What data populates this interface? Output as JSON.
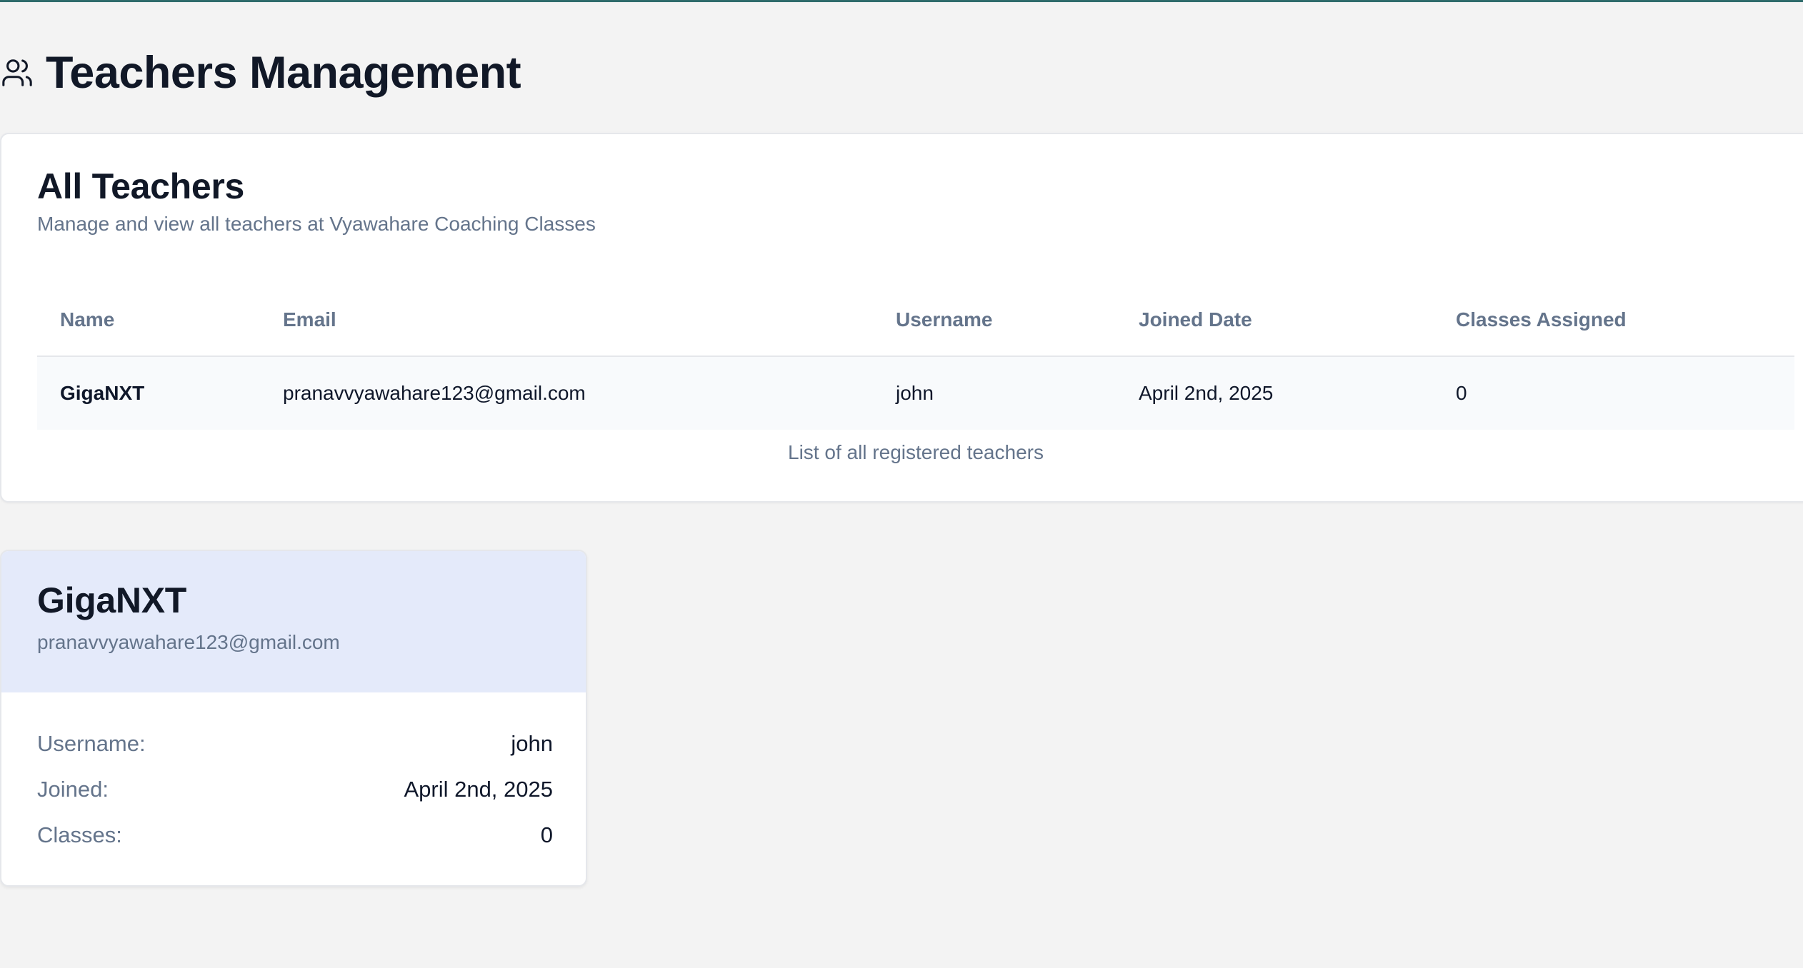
{
  "page": {
    "title": "Teachers Management",
    "icon": "users-icon"
  },
  "all_teachers": {
    "title": "All Teachers",
    "description": "Manage and view all teachers at Vyawahare Coaching Classes",
    "columns": [
      "Name",
      "Email",
      "Username",
      "Joined Date",
      "Classes Assigned"
    ],
    "rows": [
      {
        "name": "GigaNXT",
        "email": "pranavvyawahare123@gmail.com",
        "username": "john",
        "joined": "April 2nd, 2025",
        "classes": "0"
      }
    ],
    "caption": "List of all registered teachers"
  },
  "teacher_card": {
    "name": "GigaNXT",
    "email": "pranavvyawahare123@gmail.com",
    "details": [
      {
        "label": "Username:",
        "value": "john"
      },
      {
        "label": "Joined:",
        "value": "April 2nd, 2025"
      },
      {
        "label": "Classes:",
        "value": "0"
      }
    ]
  },
  "colors": {
    "accent_border": "#2e6b6b",
    "card_header_bg": "#e4eafa",
    "page_bg": "#f3f3f3",
    "muted_text": "#64748b"
  }
}
